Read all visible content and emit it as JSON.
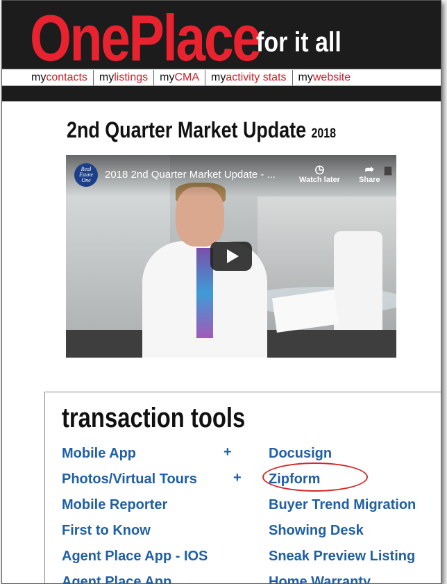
{
  "header": {
    "logo_text": "OnePlace",
    "tagline": "for it all"
  },
  "nav": {
    "items": [
      {
        "prefix": "my",
        "accent": "contacts"
      },
      {
        "prefix": "my",
        "accent": "listings"
      },
      {
        "prefix": "my",
        "accent": "CMA"
      },
      {
        "prefix": "my",
        "accent": "activity stats"
      },
      {
        "prefix": "my",
        "accent": "website"
      }
    ]
  },
  "section": {
    "title": "2nd Quarter Market Update",
    "year": "2018"
  },
  "video": {
    "channel_label": "Real Estate One",
    "title": "2018 2nd Quarter Market Update - ...",
    "watch_later_label": "Watch later",
    "share_label": "Share"
  },
  "tools": {
    "title": "transaction tools",
    "left_column": [
      "Mobile App",
      "Photos/Virtual Tours",
      "Mobile Reporter",
      "First to Know",
      "Agent Place App - IOS",
      "Agent Place App"
    ],
    "left_plus": [
      "+",
      "+"
    ],
    "right_column": [
      "Docusign",
      "Zipform",
      "Buyer Trend Migration",
      "Showing Desk",
      "Sneak Preview Listing",
      "Home Warranty"
    ]
  },
  "colors": {
    "brand_red": "#e8232f",
    "link_blue": "#1f5fa5",
    "header_black": "#1c1c1c",
    "highlight_red": "#d12a2a"
  }
}
